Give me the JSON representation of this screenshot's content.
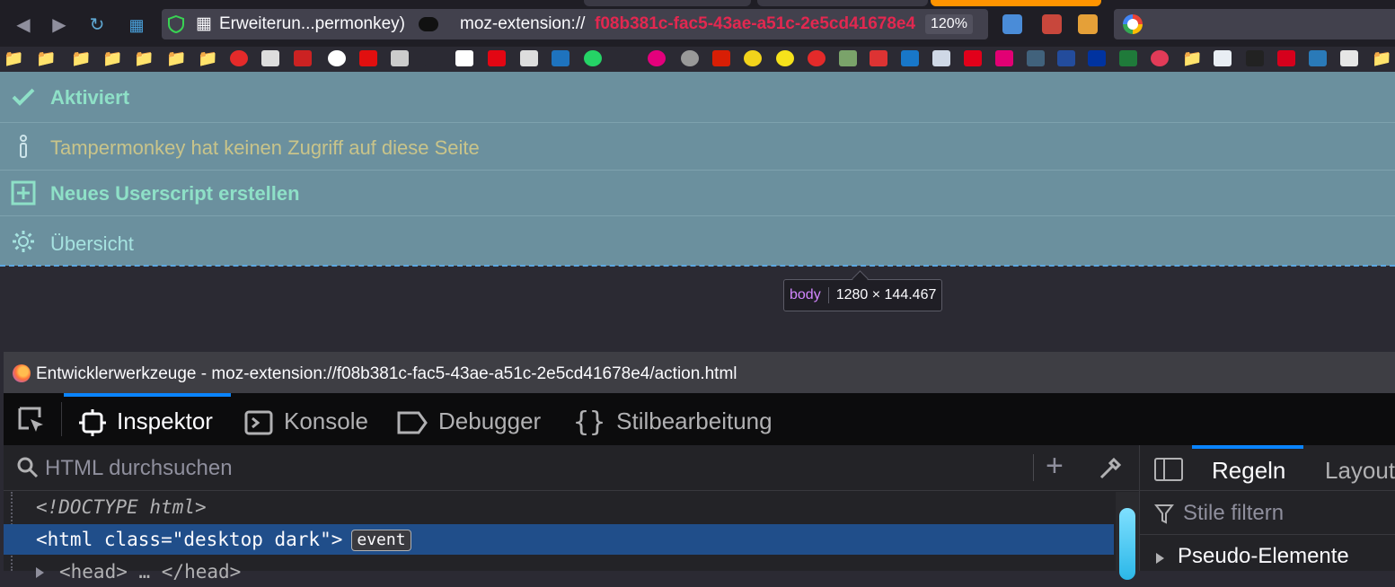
{
  "browser": {
    "urlbar": {
      "site_name": "Erweiterun...permonkey)",
      "url_prefix": "moz-extension://",
      "url_host": "f08b381c-fac5-43ae-a51c-2e5cd41678e4",
      "zoom": "120%"
    },
    "colors": {
      "url_host": "#e22850",
      "accent": "#0a84ff"
    }
  },
  "tampermonkey": {
    "rows": [
      {
        "icon": "checkmark-icon",
        "label": "Aktiviert"
      },
      {
        "icon": "info-icon",
        "label": "Tampermonkey hat keinen Zugriff auf diese Seite"
      },
      {
        "icon": "plus-square-icon",
        "label": "Neues Userscript erstellen"
      },
      {
        "icon": "gear-icon",
        "label": "Übersicht"
      }
    ],
    "colors": {
      "background": "#6b909e",
      "label": "#8ee0c7",
      "notice": "#c9c48a",
      "overview": "#a6e3e0"
    }
  },
  "tooltip": {
    "tag": "body",
    "size": "1280 × 144.467"
  },
  "devtools": {
    "title": "Entwicklerwerkzeuge - moz-extension://f08b381c-fac5-43ae-a51c-2e5cd41678e4/action.html",
    "tabs": [
      {
        "label": "Inspektor",
        "icon": "inspector-icon",
        "active": true
      },
      {
        "label": "Konsole",
        "icon": "console-icon"
      },
      {
        "label": "Debugger",
        "icon": "debugger-icon"
      },
      {
        "label": "Stilbearbeitung",
        "icon": "style-editor-icon"
      }
    ],
    "markup": {
      "search_placeholder": "HTML durchsuchen",
      "lines": [
        {
          "code": "<!DOCTYPE html>"
        },
        {
          "code": "<html class=\"desktop dark\">",
          "badge": "event"
        },
        {
          "code": "<head> … </head>"
        }
      ]
    },
    "rules": {
      "tabs": [
        "Regeln",
        "Layout"
      ],
      "filter_placeholder": "Stile filtern",
      "pseudo_label": "Pseudo-Elemente"
    }
  }
}
